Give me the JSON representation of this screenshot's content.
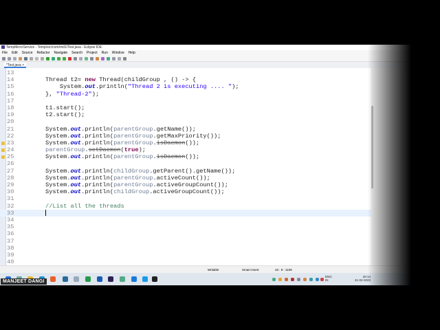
{
  "window": {
    "title": "TempMicroService - Temp/src/com/md1/Test.java - Eclipse IDE"
  },
  "menu": [
    "File",
    "Edit",
    "Source",
    "Refactor",
    "Navigate",
    "Search",
    "Project",
    "Run",
    "Window",
    "Help"
  ],
  "tab": {
    "label": "*Test.java",
    "close": "×"
  },
  "editor": {
    "lines": [
      {
        "n": "13",
        "segs": []
      },
      {
        "n": "14",
        "segs": [
          [
            "Thread t2= ",
            ""
          ],
          [
            "new",
            "k"
          ],
          [
            " Thread(childGroup , () -> {",
            ""
          ]
        ]
      },
      {
        "n": "15",
        "segs": [
          [
            "    System.",
            ""
          ],
          [
            "out",
            "f"
          ],
          [
            ".println(",
            ""
          ],
          [
            "\"Thread 2 is executing .... \"",
            "s"
          ],
          [
            ");",
            ""
          ]
        ]
      },
      {
        "n": "16",
        "segs": [
          [
            "}, ",
            ""
          ],
          [
            "\"Thread-2\"",
            "s"
          ],
          [
            ");",
            ""
          ]
        ]
      },
      {
        "n": "17",
        "segs": []
      },
      {
        "n": "18",
        "segs": [
          [
            "t1.start();",
            ""
          ]
        ]
      },
      {
        "n": "19",
        "segs": [
          [
            "t2.start();",
            ""
          ]
        ]
      },
      {
        "n": "20",
        "segs": []
      },
      {
        "n": "21",
        "segs": [
          [
            "System.",
            ""
          ],
          [
            "out",
            "f"
          ],
          [
            ".println(",
            ""
          ],
          [
            "parentGroup",
            "v"
          ],
          [
            ".getName());",
            ""
          ]
        ]
      },
      {
        "n": "22",
        "segs": [
          [
            "System.",
            ""
          ],
          [
            "out",
            "f"
          ],
          [
            ".println(",
            ""
          ],
          [
            "parentGroup",
            "v"
          ],
          [
            ".getMaxPriority());",
            ""
          ]
        ]
      },
      {
        "n": "23",
        "warn": true,
        "segs": [
          [
            "System.",
            ""
          ],
          [
            "out",
            "f"
          ],
          [
            ".println(",
            ""
          ],
          [
            "parentGroup",
            "v"
          ],
          [
            ".",
            ""
          ],
          [
            "isDaemon",
            "d"
          ],
          [
            "());",
            ""
          ]
        ]
      },
      {
        "n": "24",
        "warn": true,
        "segs": [
          [
            "parentGroup",
            "v"
          ],
          [
            ".",
            ""
          ],
          [
            "setDaemon",
            "d"
          ],
          [
            "(",
            ""
          ],
          [
            "true",
            "k"
          ],
          [
            ");",
            ""
          ]
        ]
      },
      {
        "n": "25",
        "warn": true,
        "segs": [
          [
            "System.",
            ""
          ],
          [
            "out",
            "f"
          ],
          [
            ".println(",
            ""
          ],
          [
            "parentGroup",
            "v"
          ],
          [
            ".",
            ""
          ],
          [
            "isDaemon",
            "d"
          ],
          [
            "());",
            ""
          ]
        ]
      },
      {
        "n": "26",
        "segs": []
      },
      {
        "n": "27",
        "segs": [
          [
            "System.",
            ""
          ],
          [
            "out",
            "f"
          ],
          [
            ".println(",
            ""
          ],
          [
            "childGroup",
            "v"
          ],
          [
            ".getParent().getName());",
            ""
          ]
        ]
      },
      {
        "n": "28",
        "segs": [
          [
            "System.",
            ""
          ],
          [
            "out",
            "f"
          ],
          [
            ".println(",
            ""
          ],
          [
            "parentGroup",
            "v"
          ],
          [
            ".activeCount());",
            ""
          ]
        ]
      },
      {
        "n": "29",
        "segs": [
          [
            "System.",
            ""
          ],
          [
            "out",
            "f"
          ],
          [
            ".println(",
            ""
          ],
          [
            "parentGroup",
            "v"
          ],
          [
            ".activeGroupCount());",
            ""
          ]
        ]
      },
      {
        "n": "30",
        "segs": [
          [
            "System.",
            ""
          ],
          [
            "out",
            "f"
          ],
          [
            ".println(",
            ""
          ],
          [
            "childGroup",
            "v"
          ],
          [
            ".activeGroupCount());",
            ""
          ]
        ]
      },
      {
        "n": "31",
        "segs": []
      },
      {
        "n": "32",
        "segs": [
          [
            "//List all the threads",
            "c"
          ]
        ]
      },
      {
        "n": "33",
        "cur": true,
        "segs": []
      },
      {
        "n": "34",
        "segs": []
      },
      {
        "n": "35",
        "segs": []
      },
      {
        "n": "36",
        "segs": []
      },
      {
        "n": "37",
        "segs": []
      },
      {
        "n": "38",
        "segs": []
      },
      {
        "n": "39",
        "segs": []
      },
      {
        "n": "40",
        "segs": []
      }
    ]
  },
  "status": {
    "mode": "Writable",
    "insert": "Smart Insert",
    "position": "33 : 9 : 1109"
  },
  "taskbar": {
    "lang": "ENG",
    "region": "IN",
    "time": "20:14",
    "date": "21-02-2023"
  },
  "caption": "MANJEET DANGI",
  "colors": {
    "accent": "#3a7bd5",
    "keyword": "#7f0055",
    "string": "#2a00ff",
    "comment": "#3f7f5f"
  }
}
